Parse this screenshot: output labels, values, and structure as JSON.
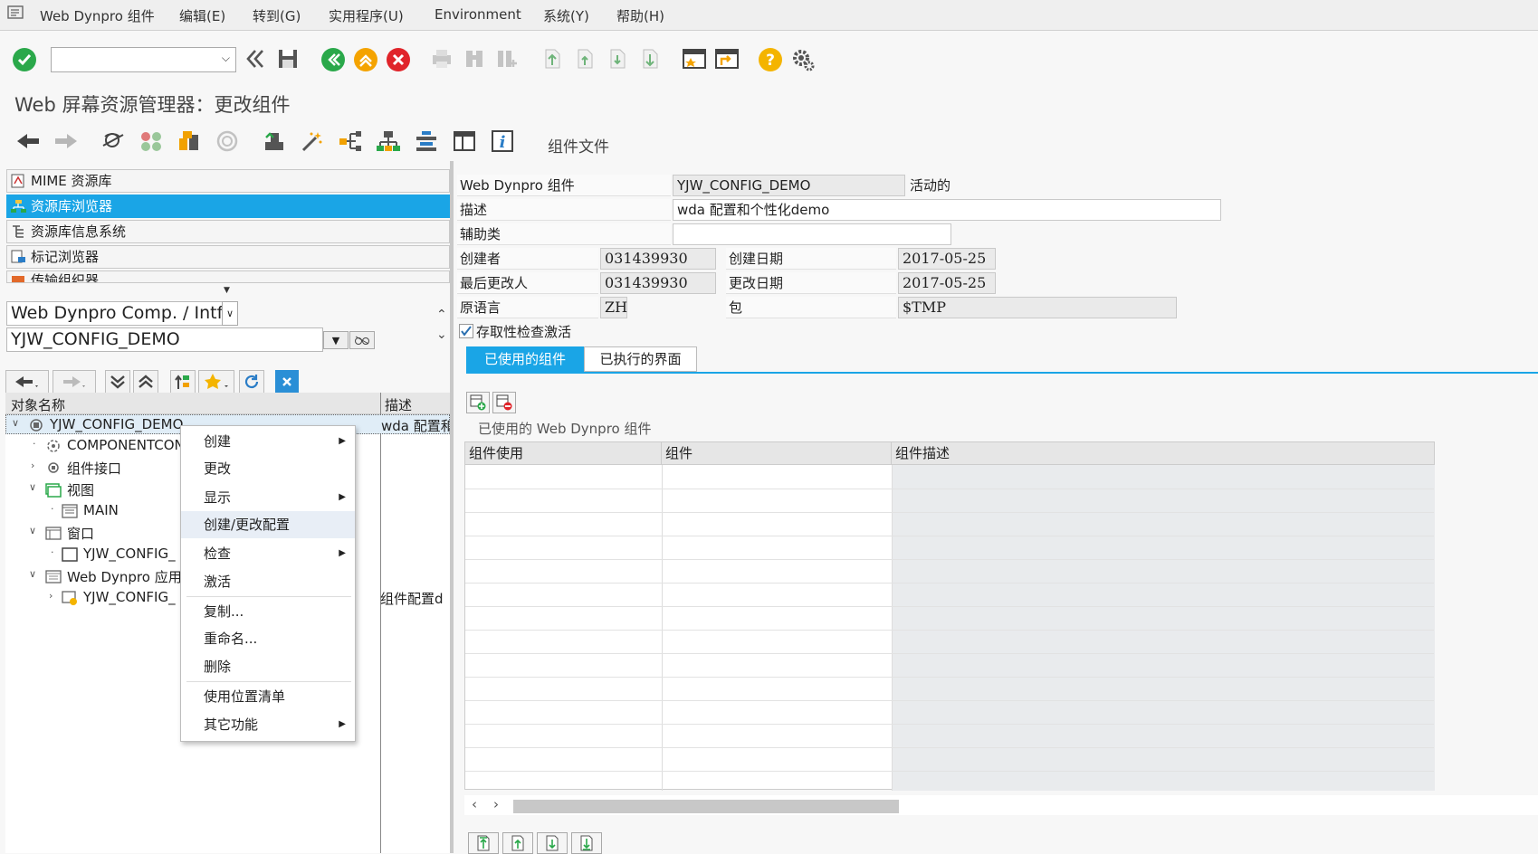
{
  "menubar": {
    "items": [
      "Web Dynpro 组件",
      "编辑(E)",
      "转到(G)",
      "实用程序(U)",
      "Environment",
      "系统(Y)",
      "帮助(H)"
    ]
  },
  "window_title": "Web 屏幕资源管理器：更改组件",
  "toolbar2": {
    "label": "组件文件"
  },
  "nav": {
    "items": [
      "MIME 资源库",
      "资源库浏览器",
      "资源库信息系统",
      "标记浏览器",
      "传输组织器"
    ],
    "active_index": 1
  },
  "object_type": {
    "value": "Web Dynpro Comp. / Intf."
  },
  "object_name": {
    "value": "YJW_CONFIG_DEMO"
  },
  "tree": {
    "col_name": "对象名称",
    "col_desc": "描述",
    "rows": [
      {
        "label": "YJW_CONFIG_DEMO",
        "desc": "wda 配置和"
      },
      {
        "label": "COMPONENTCON",
        "desc": ""
      },
      {
        "label": "组件接口",
        "desc": ""
      },
      {
        "label": "视图",
        "desc": ""
      },
      {
        "label": "MAIN",
        "desc": ""
      },
      {
        "label": "窗口",
        "desc": ""
      },
      {
        "label": "YJW_CONFIG_",
        "desc": ""
      },
      {
        "label": "Web Dynpro 应用",
        "desc": ""
      },
      {
        "label": "YJW_CONFIG_",
        "desc": "组件配置d"
      }
    ]
  },
  "context_menu": {
    "items": [
      "创建",
      "更改",
      "显示",
      "创建/更改配置",
      "检查",
      "激活",
      "复制...",
      "重命名...",
      "删除",
      "使用位置清单",
      "其它功能"
    ],
    "highlighted": "创建/更改配置"
  },
  "form": {
    "component_label": "Web Dynpro 组件",
    "component_value": "YJW_CONFIG_DEMO",
    "status": "活动的",
    "desc_label": "描述",
    "desc_value": "wda 配置和个性化demo",
    "assist_label": "辅助类",
    "assist_value": "",
    "creator_label": "创建者",
    "creator_value": "031439930",
    "created_on_label": "创建日期",
    "created_on_value": "2017-05-25",
    "changer_label": "最后更改人",
    "changer_value": "031439930",
    "changed_on_label": "更改日期",
    "changed_on_value": "2017-05-25",
    "lang_label": "原语言",
    "lang_value": "ZH",
    "package_label": "包",
    "package_value": "$TMP",
    "checkbox_label": "存取性检查激活",
    "checkbox_checked": true
  },
  "tabs": [
    "已使用的组件",
    "已执行的界面"
  ],
  "grid": {
    "caption": "已使用的 Web Dynpro 组件",
    "columns": [
      "组件使用",
      "组件",
      "组件描述"
    ]
  },
  "colors": {
    "accent": "#1aa5e6",
    "ok_green": "#2aa84a",
    "cancel_red": "#e0242a",
    "warn_orange": "#f4a300"
  }
}
